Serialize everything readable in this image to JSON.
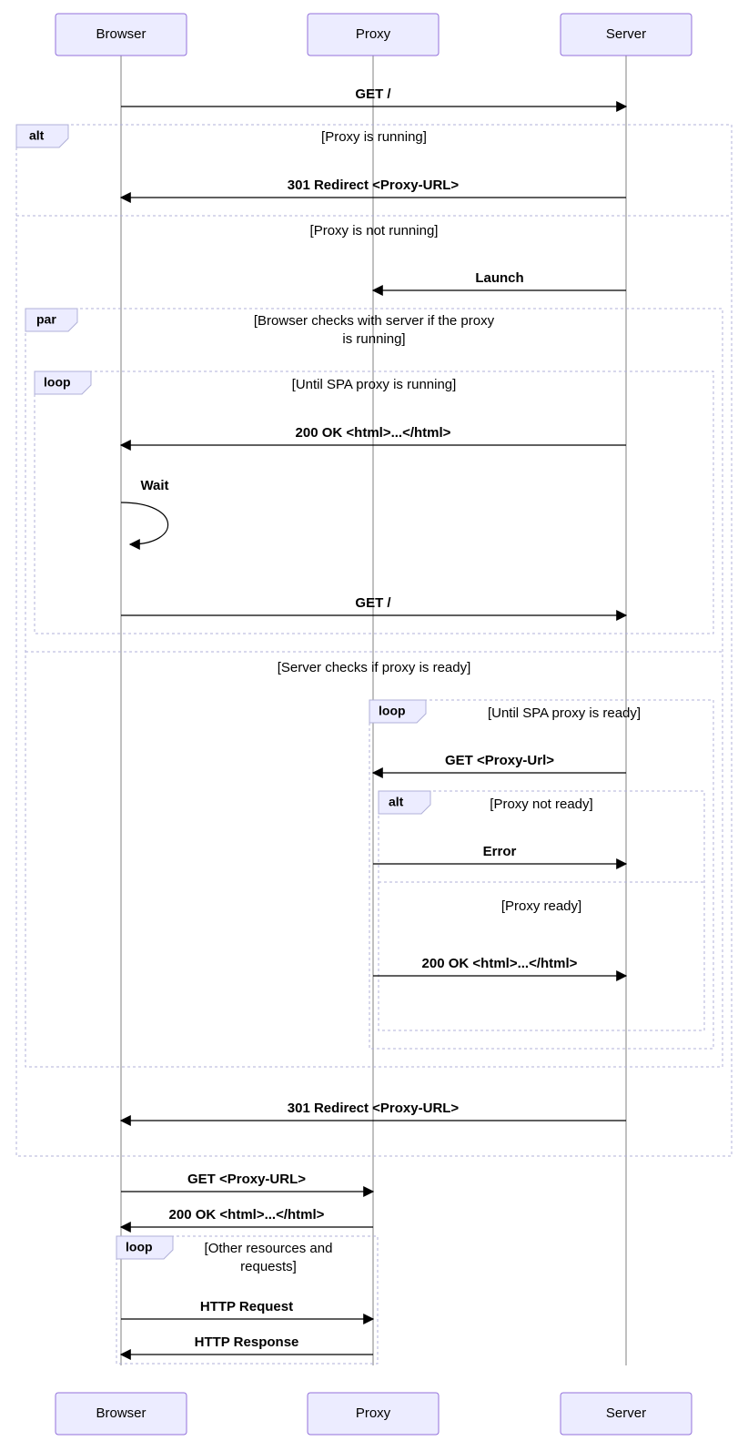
{
  "participants": {
    "browser": "Browser",
    "proxy": "Proxy",
    "server": "Server"
  },
  "messages": {
    "m1": "GET /",
    "m2": "301 Redirect <Proxy-URL>",
    "m3": "Launch",
    "m4": "200 OK <html>...</html>",
    "m5": "Wait",
    "m6": "GET /",
    "m7": "GET <Proxy-Url>",
    "m8": "Error",
    "m9": "200 OK <html>...</html>",
    "m10": "301 Redirect <Proxy-URL>",
    "m11": "GET <Proxy-URL>",
    "m12": "200 OK <html>...</html>",
    "m13": "HTTP Request",
    "m14": "HTTP Response"
  },
  "fragments": {
    "alt_label": "alt",
    "par_label": "par",
    "loop_label": "loop",
    "cond_proxy_running": "[Proxy is running]",
    "cond_proxy_not_running": "[Proxy is not running]",
    "cond_browser_checks_line1": "[Browser checks with server if the proxy",
    "cond_browser_checks_line2": "is running]",
    "cond_until_spa_running": "[Until SPA proxy is running]",
    "cond_server_checks": "[Server checks if proxy is ready]",
    "cond_until_spa_ready": "[Until SPA proxy is ready]",
    "cond_proxy_not_ready": "[Proxy not ready]",
    "cond_proxy_ready": "[Proxy ready]",
    "cond_other_resources_line1": "[Other resources and",
    "cond_other_resources_line2": "requests]"
  }
}
